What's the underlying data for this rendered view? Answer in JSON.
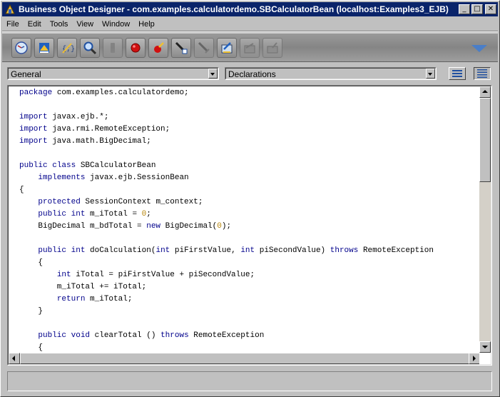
{
  "window": {
    "title": "Business Object Designer - com.examples.calculatordemo.SBCalculatorBean  (localhost:Examples3_EJB)",
    "controls": {
      "minimize": "_",
      "maximize": "□",
      "close": "✕"
    }
  },
  "menu": [
    "File",
    "Edit",
    "Tools",
    "View",
    "Window",
    "Help"
  ],
  "toolbar": {
    "buttons": [
      {
        "icon": "properties-gauge-icon",
        "enabled": true
      },
      {
        "icon": "deploy-icon",
        "enabled": true
      },
      {
        "icon": "compile-icon",
        "enabled": true
      },
      {
        "icon": "magnifier-icon",
        "enabled": true
      },
      {
        "icon": "stop-icon",
        "enabled": false
      },
      {
        "icon": "breakpoint-icon",
        "enabled": true
      },
      {
        "icon": "run-icon",
        "enabled": true
      },
      {
        "icon": "step-into-icon",
        "enabled": true
      },
      {
        "icon": "step-over-icon",
        "enabled": false
      },
      {
        "icon": "edit-bean-icon",
        "enabled": true
      },
      {
        "icon": "package-icon",
        "enabled": false
      },
      {
        "icon": "export-icon",
        "enabled": false
      }
    ],
    "expand_icon": "chevron-down-icon"
  },
  "selectors": {
    "object": "General",
    "procedure": "Declarations"
  },
  "view_toggle": {
    "procedure_view_icon": "procedure-view-icon",
    "full_module_view_icon": "full-module-view-icon",
    "active": "full-module"
  },
  "editor": {
    "lines": [
      [
        {
          "t": "package",
          "c": "kw"
        },
        {
          "t": " com.examples.calculatordemo;"
        }
      ],
      [],
      [
        {
          "t": "import",
          "c": "kw"
        },
        {
          "t": " javax.ejb.*;"
        }
      ],
      [
        {
          "t": "import",
          "c": "kw"
        },
        {
          "t": " java.rmi.RemoteException;"
        }
      ],
      [
        {
          "t": "import",
          "c": "kw"
        },
        {
          "t": " java.math.BigDecimal;"
        }
      ],
      [],
      [
        {
          "t": "public",
          "c": "kw"
        },
        {
          "t": " "
        },
        {
          "t": "class",
          "c": "kw"
        },
        {
          "t": " SBCalculatorBean"
        }
      ],
      [
        {
          "t": "    "
        },
        {
          "t": "implements",
          "c": "kw"
        },
        {
          "t": " javax.ejb.SessionBean"
        }
      ],
      [
        {
          "t": "{"
        }
      ],
      [
        {
          "t": "    "
        },
        {
          "t": "protected",
          "c": "kw"
        },
        {
          "t": " SessionContext m_context;"
        }
      ],
      [
        {
          "t": "    "
        },
        {
          "t": "public",
          "c": "kw"
        },
        {
          "t": " "
        },
        {
          "t": "int",
          "c": "kw"
        },
        {
          "t": " m_iTotal = "
        },
        {
          "t": "0",
          "c": "num"
        },
        {
          "t": ";"
        }
      ],
      [
        {
          "t": "    BigDecimal m_bdTotal = "
        },
        {
          "t": "new",
          "c": "kw"
        },
        {
          "t": " BigDecimal("
        },
        {
          "t": "0",
          "c": "num"
        },
        {
          "t": ");"
        }
      ],
      [],
      [
        {
          "t": "    "
        },
        {
          "t": "public",
          "c": "kw"
        },
        {
          "t": " "
        },
        {
          "t": "int",
          "c": "kw"
        },
        {
          "t": " doCalculation("
        },
        {
          "t": "int",
          "c": "kw"
        },
        {
          "t": " piFirstValue, "
        },
        {
          "t": "int",
          "c": "kw"
        },
        {
          "t": " piSecondValue) "
        },
        {
          "t": "throws",
          "c": "kw"
        },
        {
          "t": " RemoteException"
        }
      ],
      [
        {
          "t": "    {"
        }
      ],
      [
        {
          "t": "        "
        },
        {
          "t": "int",
          "c": "kw"
        },
        {
          "t": " iTotal = piFirstValue + piSecondValue;"
        }
      ],
      [
        {
          "t": "        m_iTotal += iTotal;"
        }
      ],
      [
        {
          "t": "        "
        },
        {
          "t": "return",
          "c": "kw"
        },
        {
          "t": " m_iTotal;"
        }
      ],
      [
        {
          "t": "    }"
        }
      ],
      [],
      [
        {
          "t": "    "
        },
        {
          "t": "public",
          "c": "kw"
        },
        {
          "t": " "
        },
        {
          "t": "void",
          "c": "kw"
        },
        {
          "t": " clearTotal () "
        },
        {
          "t": "throws",
          "c": "kw"
        },
        {
          "t": " RemoteException"
        }
      ],
      [
        {
          "t": "    {"
        }
      ]
    ],
    "vertical_scroll_position": 0.0,
    "horizontal_scroll_position": 0.0
  },
  "status": {
    "text": ""
  }
}
